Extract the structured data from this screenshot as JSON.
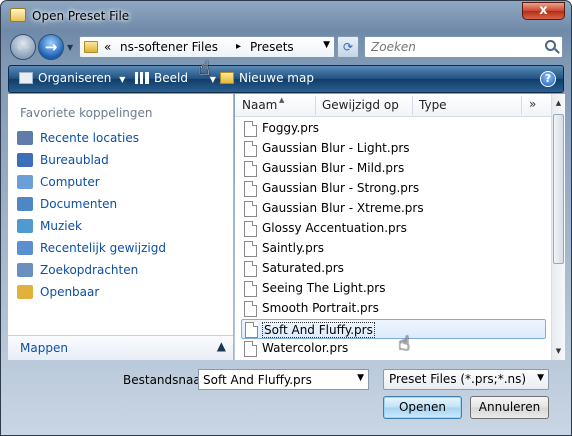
{
  "window": {
    "title": "Open Preset File",
    "close_glyph": "x"
  },
  "nav": {
    "back_glyph": "←",
    "forward_glyph": "→"
  },
  "address": {
    "overflow": "«",
    "crumbs": [
      "ns-softener Files",
      "Presets"
    ],
    "separator": "▸",
    "search_placeholder": "Zoeken"
  },
  "toolbar": {
    "organize_label": "Organiseren",
    "view_label": "Beeld",
    "new_folder_label": "Nieuwe map",
    "dropdown_glyph": "▼",
    "help_glyph": "?"
  },
  "sidebar": {
    "header": "Favoriete koppelingen",
    "items": [
      {
        "label": "Recente locaties",
        "icon": "recent-places-icon",
        "color": "#5f7da8"
      },
      {
        "label": "Bureaublad",
        "icon": "desktop-icon",
        "color": "#3d6fb8"
      },
      {
        "label": "Computer",
        "icon": "computer-icon",
        "color": "#6aa0d8"
      },
      {
        "label": "Documenten",
        "icon": "documents-icon",
        "color": "#4f86c4"
      },
      {
        "label": "Muziek",
        "icon": "music-icon",
        "color": "#4f9bd0"
      },
      {
        "label": "Recentelijk gewijzigd",
        "icon": "recently-changed-icon",
        "color": "#5c8fcf"
      },
      {
        "label": "Zoekopdrachten",
        "icon": "searches-icon",
        "color": "#6b8fbf"
      },
      {
        "label": "Openbaar",
        "icon": "public-folder-icon",
        "color": "#e1b13e"
      }
    ],
    "folders_label": "Mappen",
    "folders_chevron": "▲"
  },
  "filelist": {
    "columns": [
      "Naam",
      "Gewijzigd op",
      "Type"
    ],
    "more_glyph": "»",
    "sort_glyph": "▲",
    "files": [
      "Foggy.prs",
      "Gaussian Blur - Light.prs",
      "Gaussian Blur - Mild.prs",
      "Gaussian Blur - Strong.prs",
      "Gaussian Blur - Xtreme.prs",
      "Glossy Accentuation.prs",
      "Saintly.prs",
      "Saturated.prs",
      "Seeing The Light.prs",
      "Smooth Portrait.prs",
      "Soft And Fluffy.prs",
      "Watercolor.prs"
    ],
    "selected": "Soft And Fluffy.prs",
    "scroll_up_glyph": "▲",
    "scroll_down_glyph": "▼"
  },
  "footer": {
    "filename_label": "Bestandsnaam:",
    "filename_value": "Soft And Fluffy.prs",
    "filetype_value": "Preset Files (*.prs;*.ns)",
    "open_label": "Openen",
    "cancel_label": "Annuleren",
    "dropdown_glyph": "▼"
  },
  "cursor_glyph": "☝"
}
